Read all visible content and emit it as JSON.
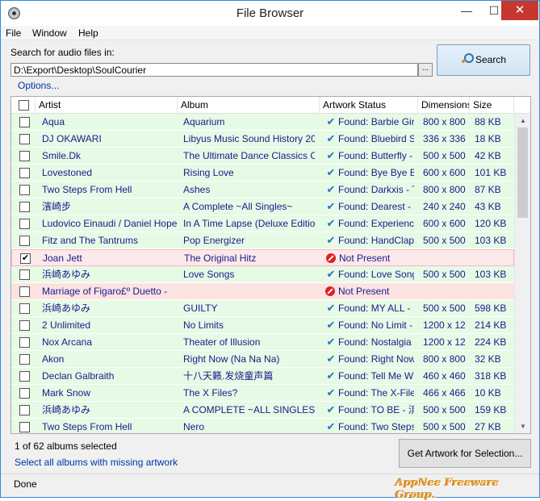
{
  "window": {
    "title": "File Browser"
  },
  "menu": [
    "File",
    "Window",
    "Help"
  ],
  "search": {
    "label": "Search for audio files in:",
    "path": "D:\\Export\\Desktop\\SoulCourier",
    "browse_label": "...",
    "button_label": "Search"
  },
  "options_label": "Options...",
  "table": {
    "columns": [
      "Artist",
      "Album",
      "Artwork Status",
      "Dimensions",
      "Size"
    ],
    "rows": [
      {
        "checked": false,
        "artist": "Aqua",
        "album": "Aquarium",
        "status": "Found: Barbie Gir",
        "found": true,
        "dimensions": "800 x 800",
        "size": "88 KB"
      },
      {
        "checked": false,
        "artist": "DJ OKAWARI",
        "album": "Libyus Music Sound History 20",
        "status": "Found: Bluebird S",
        "found": true,
        "dimensions": "336 x 336",
        "size": "18 KB"
      },
      {
        "checked": false,
        "artist": "Smile.Dk",
        "album": "The Ultimate Dance Classics Co",
        "status": "Found: Butterfly -",
        "found": true,
        "dimensions": "500 x 500",
        "size": "42 KB"
      },
      {
        "checked": false,
        "artist": "Lovestoned",
        "album": "Rising Love",
        "status": "Found: Bye Bye By",
        "found": true,
        "dimensions": "600 x 600",
        "size": "101 KB"
      },
      {
        "checked": false,
        "artist": "Two Steps From Hell",
        "album": "Ashes",
        "status": "Found: Darkxis - T",
        "found": true,
        "dimensions": "800 x 800",
        "size": "87 KB"
      },
      {
        "checked": false,
        "artist": "濱崎步",
        "album": "A Complete ~All Singles~",
        "status": "Found: Dearest -",
        "found": true,
        "dimensions": "240 x 240",
        "size": "43 KB"
      },
      {
        "checked": false,
        "artist": "Ludovico Einaudi / Daniel Hope",
        "album": "In A Time Lapse (Deluxe Edition",
        "status": "Found: Experience",
        "found": true,
        "dimensions": "600 x 600",
        "size": "120 KB"
      },
      {
        "checked": false,
        "artist": "Fitz and The Tantrums",
        "album": "Pop Energizer",
        "status": "Found: HandClap",
        "found": true,
        "dimensions": "500 x 500",
        "size": "103 KB"
      },
      {
        "checked": true,
        "artist": "Joan Jett",
        "album": "The Original Hitz",
        "status": "Not Present",
        "found": false,
        "dimensions": "",
        "size": "",
        "selected": true
      },
      {
        "checked": false,
        "artist": "浜崎あゆみ",
        "album": "Love Songs",
        "status": "Found: Love Song",
        "found": true,
        "dimensions": "500 x 500",
        "size": "103 KB"
      },
      {
        "checked": false,
        "artist": "Marriage of Figaro£º Duetto -",
        "album": "",
        "status": "Not Present",
        "found": false,
        "dimensions": "",
        "size": ""
      },
      {
        "checked": false,
        "artist": "浜崎あゆみ",
        "album": "GUILTY",
        "status": "Found: MY ALL - ",
        "found": true,
        "dimensions": "500 x 500",
        "size": "598 KB"
      },
      {
        "checked": false,
        "artist": "2 Unlimited",
        "album": "No Limits",
        "status": "Found: No Limit -",
        "found": true,
        "dimensions": "1200 x 12",
        "size": "214 KB"
      },
      {
        "checked": false,
        "artist": "Nox Arcana",
        "album": "Theater of Illusion",
        "status": "Found: Nostalgia",
        "found": true,
        "dimensions": "1200 x 12",
        "size": "224 KB"
      },
      {
        "checked": false,
        "artist": "Akon",
        "album": "Right Now (Na Na Na)",
        "status": "Found: Right Now",
        "found": true,
        "dimensions": "800 x 800",
        "size": "32 KB"
      },
      {
        "checked": false,
        "artist": "Declan Galbraith",
        "album": "十八天籁.发烧童声篇",
        "status": "Found: Tell Me W",
        "found": true,
        "dimensions": "460 x 460",
        "size": "318 KB"
      },
      {
        "checked": false,
        "artist": "Mark Snow",
        "album": "The X Files?",
        "status": "Found: The X-File",
        "found": true,
        "dimensions": "466 x 466",
        "size": "10 KB"
      },
      {
        "checked": false,
        "artist": "浜崎あゆみ",
        "album": "A COMPLETE ~ALL SINGLES~",
        "status": "Found: TO BE - 浜",
        "found": true,
        "dimensions": "500 x 500",
        "size": "159 KB"
      },
      {
        "checked": false,
        "artist": "Two Steps From Hell",
        "album": "Nero",
        "status": "Found: Two Steps",
        "found": true,
        "dimensions": "500 x 500",
        "size": "27 KB"
      }
    ]
  },
  "footer": {
    "selected_count": "1 of 62 albums selected",
    "select_missing": "Select all albums with missing artwork",
    "get_artwork": "Get Artwork for Selection..."
  },
  "status": {
    "text": "Done",
    "watermark": "AppNee Freeware Group."
  },
  "colors": {
    "found_row": "#e6fae6",
    "missing_row": "#fde2e2",
    "link": "#0033aa",
    "close": "#c7372f"
  }
}
